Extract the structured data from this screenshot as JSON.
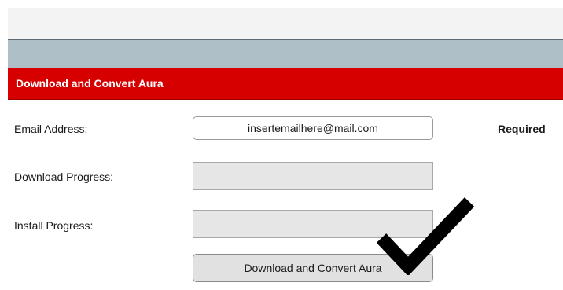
{
  "header": {
    "title": "Download and Convert Aura"
  },
  "form": {
    "email_label": "Email Address:",
    "email_value": "insertemailhere@mail.com",
    "required_label": "Required",
    "download_progress_label": "Download Progress:",
    "download_progress_value": 0,
    "install_progress_label": "Install Progress:",
    "install_progress_value": 0,
    "action_button_label": "Download and Convert Aura"
  },
  "overlay": {
    "icon": "checkmark-icon"
  },
  "colors": {
    "header_red": "#d70000",
    "toolbar_gray": "#afbfc8",
    "progress_track": "#e6e6e6"
  }
}
